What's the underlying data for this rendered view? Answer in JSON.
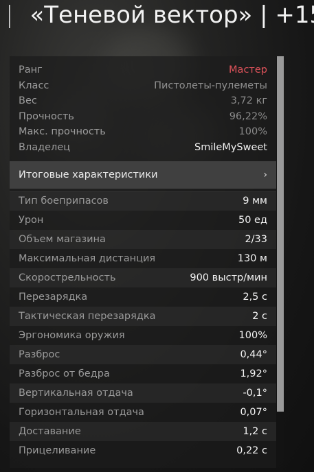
{
  "title": {
    "separator": "|",
    "name": "«Теневой вектор» | +15"
  },
  "info": [
    {
      "label": "Ранг",
      "value": "Мастер"
    },
    {
      "label": "Класс",
      "value": "Пистолеты-пулеметы"
    },
    {
      "label": "Вес",
      "value": "3,72 кг"
    },
    {
      "label": "Прочность",
      "value": "96,22%"
    },
    {
      "label": "Макс. прочность",
      "value": "100%"
    },
    {
      "label": "Владелец",
      "value": "SmileMySweet"
    }
  ],
  "summary": {
    "label": "Итоговые характеристики",
    "chevron": "›"
  },
  "stats": [
    {
      "label": "Тип боеприпасов",
      "value": "9 мм"
    },
    {
      "label": "Урон",
      "value": "50 ед"
    },
    {
      "label": "Объем магазина",
      "value": "2/33"
    },
    {
      "label": "Максимальная дистанция",
      "value": "130 м"
    },
    {
      "label": "Скорострельность",
      "value": "900 выстр/мин"
    },
    {
      "label": "Перезарядка",
      "value": "2,5 с"
    },
    {
      "label": "Тактическая перезарядка",
      "value": "2 с"
    },
    {
      "label": "Эргономика оружия",
      "value": "100%"
    },
    {
      "label": "Разброс",
      "value": "0,44°"
    },
    {
      "label": "Разброс от бедра",
      "value": "1,92°"
    },
    {
      "label": "Вертикальная отдача",
      "value": "-0,1°"
    },
    {
      "label": "Горизонтальная отдача",
      "value": "0,07°"
    },
    {
      "label": "Доставание",
      "value": "1,2 с"
    },
    {
      "label": "Прицеливание",
      "value": "0,22 с"
    }
  ],
  "colors": {
    "rank": "#e0535b",
    "summary_bg": "#404040",
    "scroll_thumb": "#9a9a9a"
  }
}
